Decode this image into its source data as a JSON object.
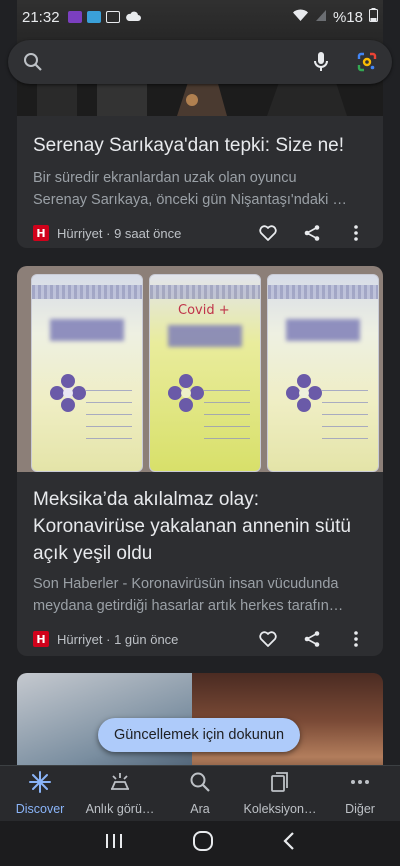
{
  "status_bar": {
    "time": "21:32",
    "battery": "%18"
  },
  "search": {
    "placeholder": ""
  },
  "cards": [
    {
      "title": "Serenay Sarıkaya'dan tepki: Size ne!",
      "snippet_line1": "Bir süredir ekranlardan uzak olan oyuncu",
      "snippet_line2": "Serenay Sarıkaya, önceki gün Nişantaşı'ndaki …",
      "source": "Hürriyet",
      "time": "9 saat önce",
      "source_logo_letter": "H"
    },
    {
      "image_text": "Covid +",
      "title_line1": "Meksika’da akılalmaz olay:",
      "title_line2": "Koronavirüse yakalanan annenin sütü",
      "title_line3": "açık yeşil oldu",
      "snippet_line1": "Son Haberler - Koronavirüsün insan vücudunda",
      "snippet_line2": "meydana getirdiği hasarlar artık herkes tarafın…",
      "source": "Hürriyet",
      "time": "1 gün önce",
      "source_logo_letter": "H"
    }
  ],
  "refresh_pill": "Güncellemek için dokunun",
  "bottom_nav": [
    {
      "label": "Discover",
      "icon": "discover-icon"
    },
    {
      "label": "Anlık görü…",
      "icon": "updates-icon"
    },
    {
      "label": "Ara",
      "icon": "search-icon"
    },
    {
      "label": "Koleksiyon…",
      "icon": "collections-icon"
    },
    {
      "label": "Diğer",
      "icon": "more-icon"
    }
  ],
  "colors": {
    "accent": "#8ab4f8",
    "background": "#202124",
    "card": "#2d2e31",
    "pill": "#aecbfa",
    "hurriyet_red": "#d0021b"
  }
}
